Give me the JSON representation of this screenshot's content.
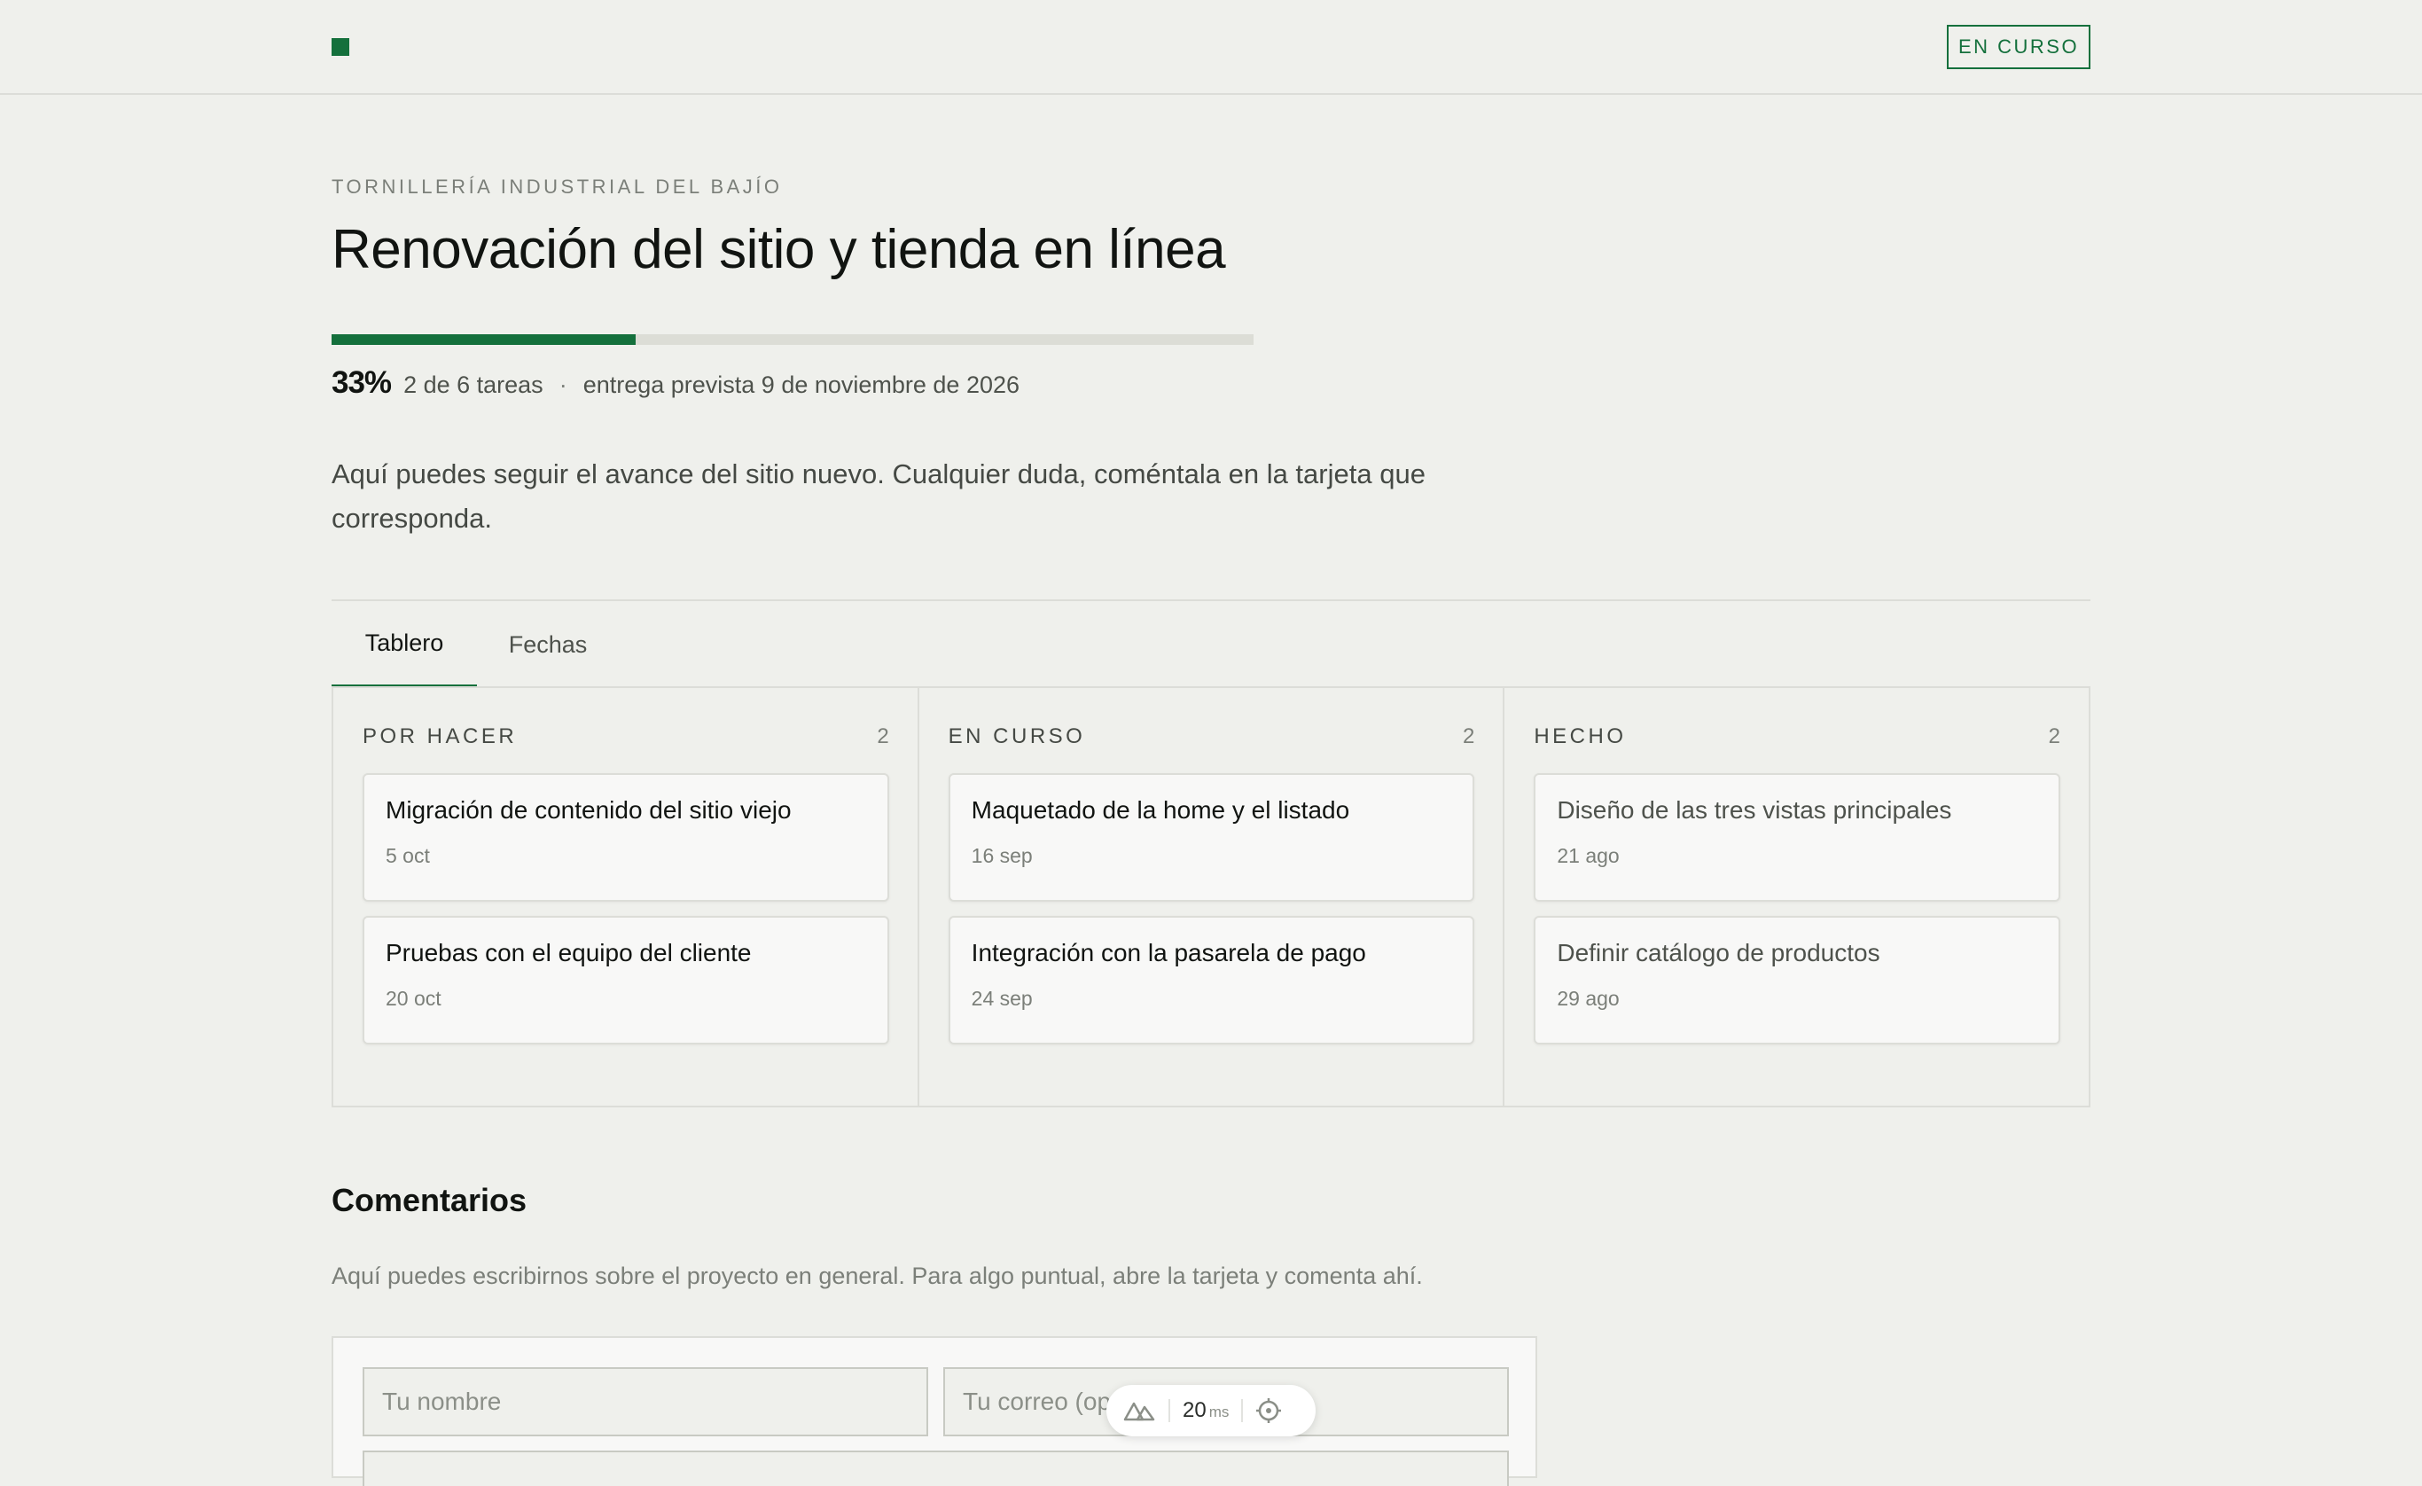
{
  "header": {
    "status_label": "EN CURSO"
  },
  "project": {
    "client": "TORNILLERÍA INDUSTRIAL DEL BAJÍO",
    "title": "Renovación del sitio y tienda en línea",
    "progress_fraction": 0.33,
    "progress_label": "33%",
    "tasks_label": "2 de 6 tareas",
    "separator": "·",
    "due_label": "entrega prevista 9 de noviembre de 2026",
    "intro": "Aquí puedes seguir el avance del sitio nuevo. Cualquier duda, coméntala en la tarjeta que corresponda."
  },
  "tabs": [
    {
      "label": "Tablero",
      "active": true
    },
    {
      "label": "Fechas",
      "active": false
    }
  ],
  "board": {
    "columns": [
      {
        "title": "POR HACER",
        "count": "2",
        "cards": [
          {
            "title": "Migración de contenido del sitio viejo",
            "date": "5 oct"
          },
          {
            "title": "Pruebas con el equipo del cliente",
            "date": "20 oct"
          }
        ]
      },
      {
        "title": "EN CURSO",
        "count": "2",
        "cards": [
          {
            "title": "Maquetado de la home y el listado",
            "date": "16 sep"
          },
          {
            "title": "Integración con la pasarela de pago",
            "date": "24 sep"
          }
        ]
      },
      {
        "title": "HECHO",
        "count": "2",
        "cards": [
          {
            "title": "Diseño de las tres vistas principales",
            "date": "21 ago"
          },
          {
            "title": "Definir catálogo de productos",
            "date": "29 ago"
          }
        ]
      }
    ]
  },
  "comments": {
    "title": "Comentarios",
    "description": "Aquí puedes escribirnos sobre el proyecto en general. Para algo puntual, abre la tarjeta y comenta ahí.",
    "name_placeholder": "Tu nombre",
    "email_placeholder": "Tu correo (opcional)"
  },
  "devbar": {
    "logo_icon": "nuxt-logo-icon",
    "ms_value": "20",
    "ms_unit": "ms",
    "target_icon": "crosshair-icon"
  },
  "colors": {
    "accent": "#14703c",
    "background": "#eff0ec",
    "border": "#dcddd8"
  }
}
